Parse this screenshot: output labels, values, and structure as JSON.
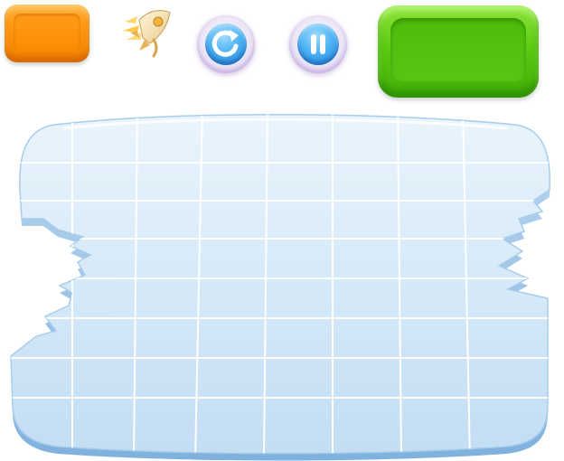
{
  "hud": {
    "score_panel": {
      "color": "#ff9a14"
    },
    "booster_icon": {
      "icon": "rocket-icon"
    },
    "refresh_button": {
      "icon": "refresh-icon",
      "color": "#2f95e6"
    },
    "pause_button": {
      "icon": "pause-icon",
      "color": "#2f95e6"
    },
    "goal_panel": {
      "color": "#5ccb12"
    }
  },
  "board": {
    "columns": 8,
    "rows": 8,
    "tile_color": "#d6e9f8",
    "grid_line_color": "#ffffff",
    "edge_color": "#9fc6e8"
  }
}
